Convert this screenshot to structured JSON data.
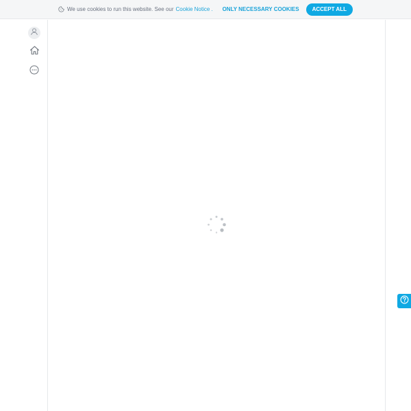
{
  "cookie_banner": {
    "icon": "cookie-icon",
    "text": "We use cookies to run this website. See our",
    "link_label": "Cookie Notice",
    "link_suffix": ".",
    "necessary_label": "ONLY NECESSARY COOKIES",
    "accept_label": "ACCEPT ALL"
  },
  "sidebar": {
    "items": [
      {
        "icon": "user-icon"
      },
      {
        "icon": "home-icon"
      },
      {
        "icon": "more-icon"
      }
    ]
  },
  "main": {
    "loading_icon": "loading-spinner-icon"
  },
  "help": {
    "icon": "help-icon"
  },
  "colors": {
    "accent": "#10a9e3",
    "link": "#1aa3d9",
    "banner_bg": "#f5f6f7",
    "border": "#e6e8ea",
    "icon": "#7a8088"
  }
}
